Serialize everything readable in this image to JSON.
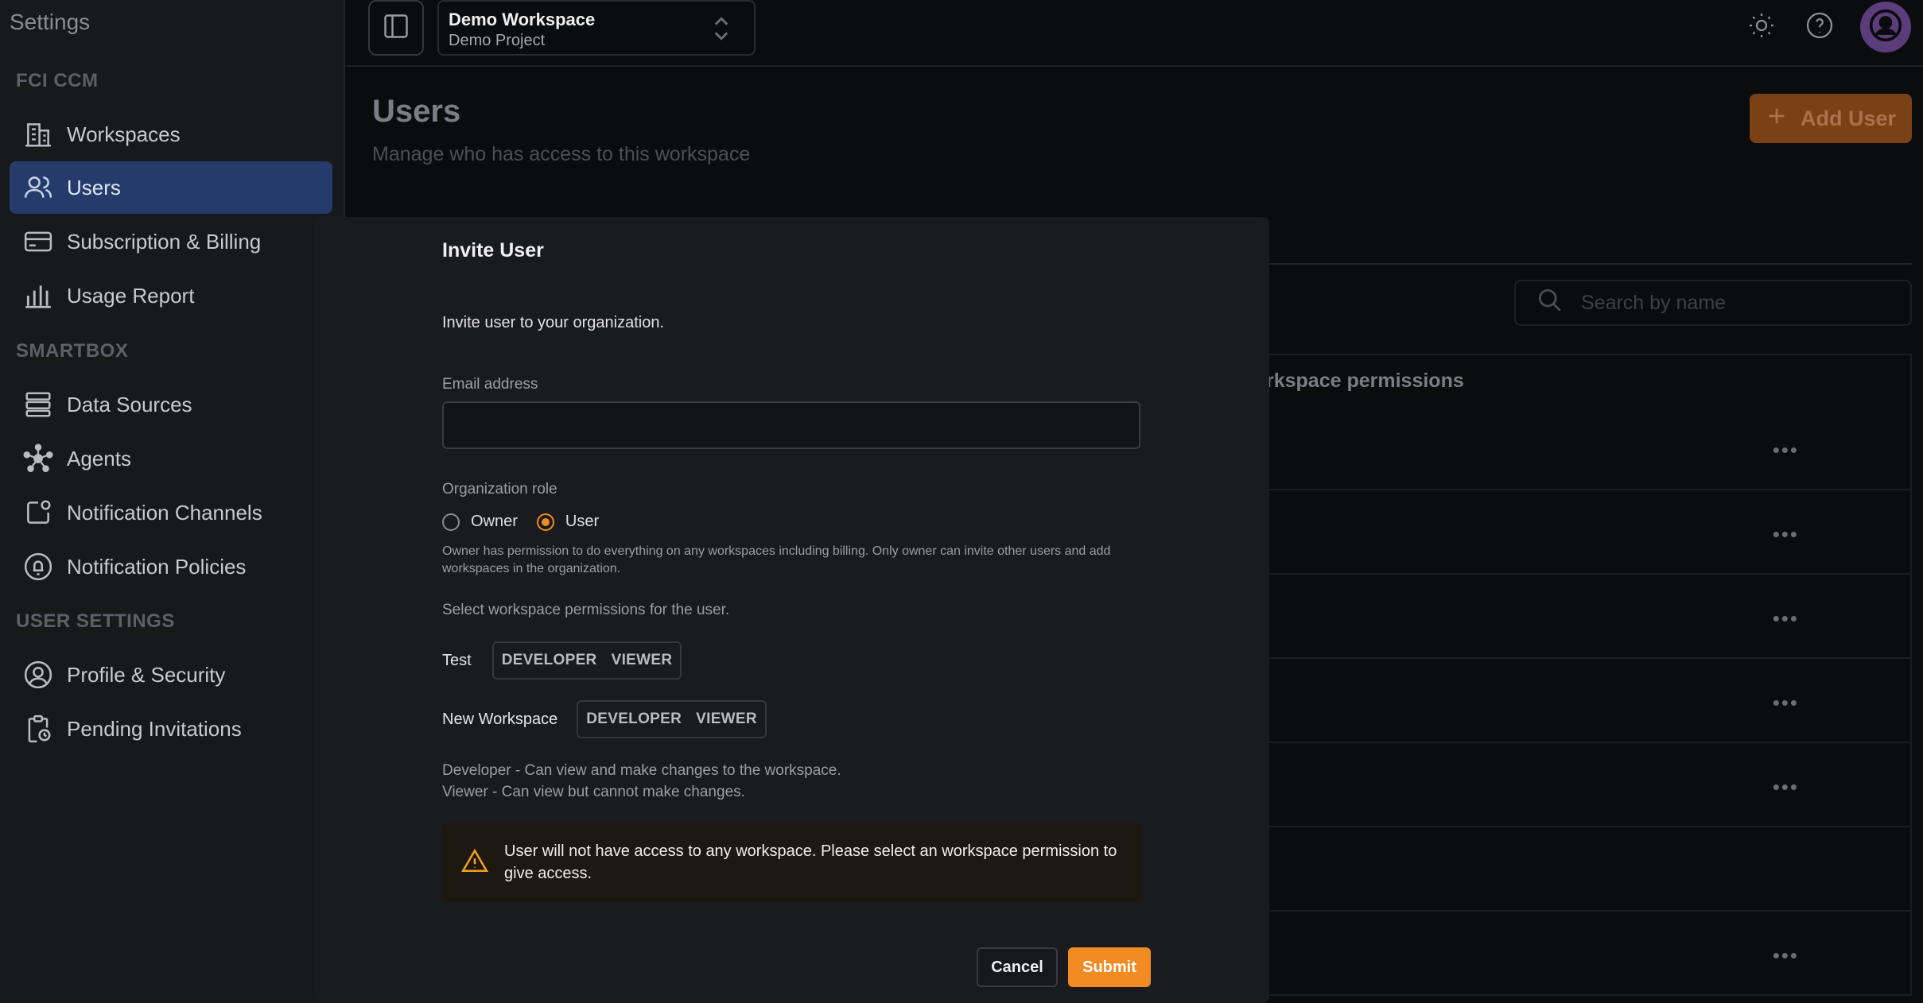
{
  "sidebar": {
    "title": "Settings",
    "sections": [
      {
        "label": "FCI CCM",
        "items": [
          {
            "label": "Workspaces",
            "icon": "building-icon"
          },
          {
            "label": "Users",
            "icon": "users-icon",
            "active": true
          },
          {
            "label": "Subscription & Billing",
            "icon": "credit-card-icon"
          },
          {
            "label": "Usage Report",
            "icon": "bar-chart-icon"
          }
        ]
      },
      {
        "label": "SMARTBOX",
        "items": [
          {
            "label": "Data Sources",
            "icon": "server-icon"
          },
          {
            "label": "Agents",
            "icon": "network-icon"
          },
          {
            "label": "Notification Channels",
            "icon": "notification-icon"
          },
          {
            "label": "Notification Policies",
            "icon": "bell-icon"
          }
        ]
      },
      {
        "label": "USER SETTINGS",
        "items": [
          {
            "label": "Profile & Security",
            "icon": "user-circle-icon"
          },
          {
            "label": "Pending Invitations",
            "icon": "clipboard-clock-icon"
          }
        ]
      }
    ]
  },
  "header": {
    "workspace_name": "Demo Workspace",
    "project_name": "Demo Project"
  },
  "page": {
    "title": "Users",
    "subtitle": "Manage who has access to this workspace",
    "add_user_label": "Add User",
    "search_placeholder": "Search by name",
    "table_header": "rkspace permissions",
    "row_action": "•••"
  },
  "modal": {
    "title": "Invite User",
    "description": "Invite user to your organization.",
    "email_label": "Email address",
    "email_value": "",
    "role_label": "Organization role",
    "role_owner": "Owner",
    "role_user": "User",
    "selected_role": "User",
    "role_help": "Owner has permission to do everything on any workspaces including billing. Only owner can invite other users and add workspaces in the organization.",
    "ws_perm_label": "Select workspace permissions for the user.",
    "workspaces": [
      {
        "name": "Test",
        "developer": "DEVELOPER",
        "viewer": "VIEWER"
      },
      {
        "name": "New Workspace",
        "developer": "DEVELOPER",
        "viewer": "VIEWER"
      }
    ],
    "legend_developer": "Developer - Can view and make changes to the workspace.",
    "legend_viewer": "Viewer - Can view but cannot make changes.",
    "warning": "User will not have access to any workspace. Please select an workspace permission to give access.",
    "cancel_label": "Cancel",
    "submit_label": "Submit"
  },
  "colors": {
    "accent": "#f28b22",
    "active_nav": "#243b6b",
    "warning_icon": "#f0a020"
  }
}
